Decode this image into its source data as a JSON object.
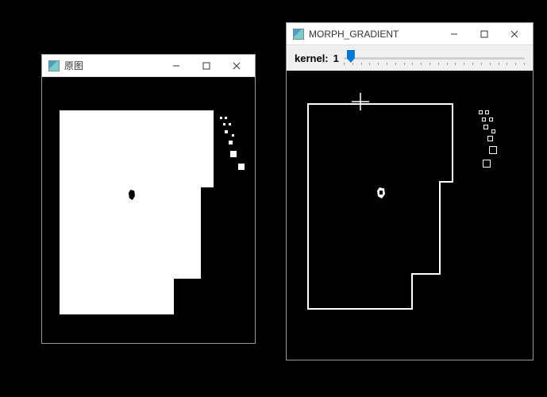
{
  "windows": {
    "original": {
      "title": "原图",
      "minimize_aria": "Minimize",
      "maximize_aria": "Maximize",
      "close_aria": "Close"
    },
    "gradient": {
      "title": "MORPH_GRADIENT",
      "minimize_aria": "Minimize",
      "maximize_aria": "Maximize",
      "close_aria": "Close"
    }
  },
  "toolbar": {
    "kernel_label": "kernel:",
    "kernel_value": "1"
  },
  "icons": {
    "app": "opencv-icon",
    "minimize": "minimize-icon",
    "maximize": "maximize-icon",
    "close": "close-icon"
  }
}
